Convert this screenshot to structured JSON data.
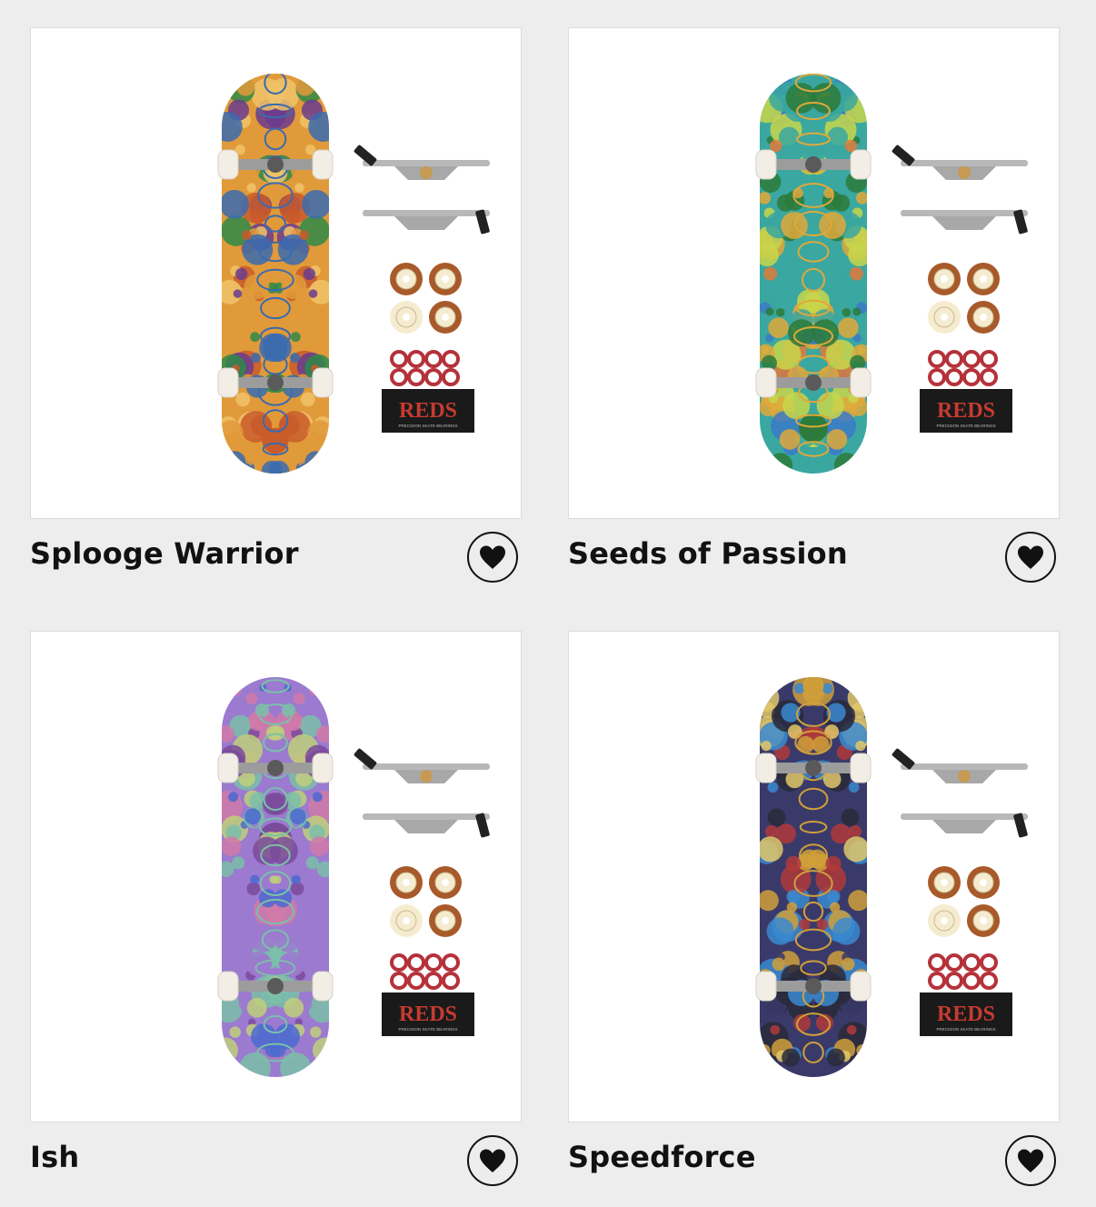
{
  "products": [
    {
      "title": "Splooge Warrior",
      "palette": [
        "#e19a3a",
        "#3a6bb0",
        "#2f8a48",
        "#c85a2a",
        "#f0c36a",
        "#6a3b8e"
      ]
    },
    {
      "title": "Seeds of Passion",
      "palette": [
        "#3aa7a0",
        "#e0a83a",
        "#2c7a3a",
        "#3b7ac8",
        "#c8d64a",
        "#e07a3a"
      ]
    },
    {
      "title": "Ish",
      "palette": [
        "#9b7ad0",
        "#7ac0a8",
        "#d07aa8",
        "#4a6ad0",
        "#c0d07a",
        "#7a4a9b"
      ]
    },
    {
      "title": "Speedforce",
      "palette": [
        "#3a3a6a",
        "#d0a03a",
        "#b03a3a",
        "#3a8ad0",
        "#e0c86a",
        "#2a2a3a"
      ]
    }
  ],
  "kit": {
    "bearing_brand": "REDS",
    "bearing_subtitle": "PRECISION SKATE BEARINGS"
  },
  "icons": {
    "favorite": "heart-icon"
  }
}
